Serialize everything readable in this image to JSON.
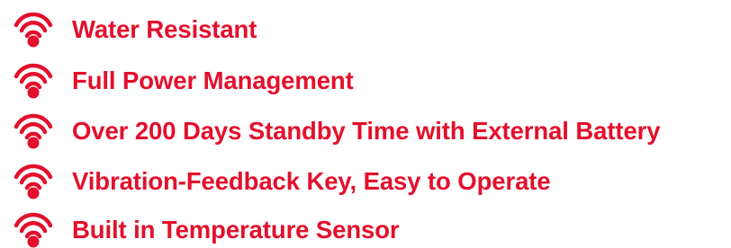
{
  "colors": {
    "accent": "#e3102c"
  },
  "features": [
    {
      "icon": "wireless-signal-icon",
      "label": "Water Resistant"
    },
    {
      "icon": "wireless-signal-icon",
      "label": "Full Power Management"
    },
    {
      "icon": "wireless-signal-icon",
      "label": "Over 200 Days Standby Time with External Battery"
    },
    {
      "icon": "wireless-signal-icon",
      "label": "Vibration-Feedback Key, Easy to Operate"
    },
    {
      "icon": "wireless-signal-icon",
      "label": "Built in Temperature Sensor"
    }
  ]
}
